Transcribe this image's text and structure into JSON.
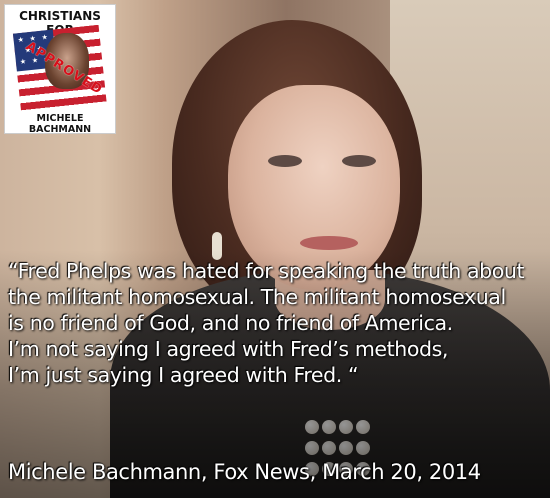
{
  "logo": {
    "top_text": "CHRISTIANS FOR",
    "stamp_text": "APPROVED",
    "bottom_text": "MICHELE BACHMANN"
  },
  "quote": {
    "lines": [
      "“Fred Phelps was hated for speaking the truth about",
      "the militant homosexual.  The militant homosexual",
      "is no friend of God, and no friend of America.",
      "I’m not saying I agreed with Fred’s methods,",
      "I’m just saying I agreed with Fred. “"
    ]
  },
  "attribution": "Michele Bachmann, Fox News, March 20, 2014",
  "colors": {
    "text": "#ffffff",
    "stamp": "#d8101b",
    "flag_red": "#c8202f",
    "flag_blue": "#243a7a"
  },
  "icons": [
    "american-flag-icon",
    "approved-stamp-icon"
  ]
}
